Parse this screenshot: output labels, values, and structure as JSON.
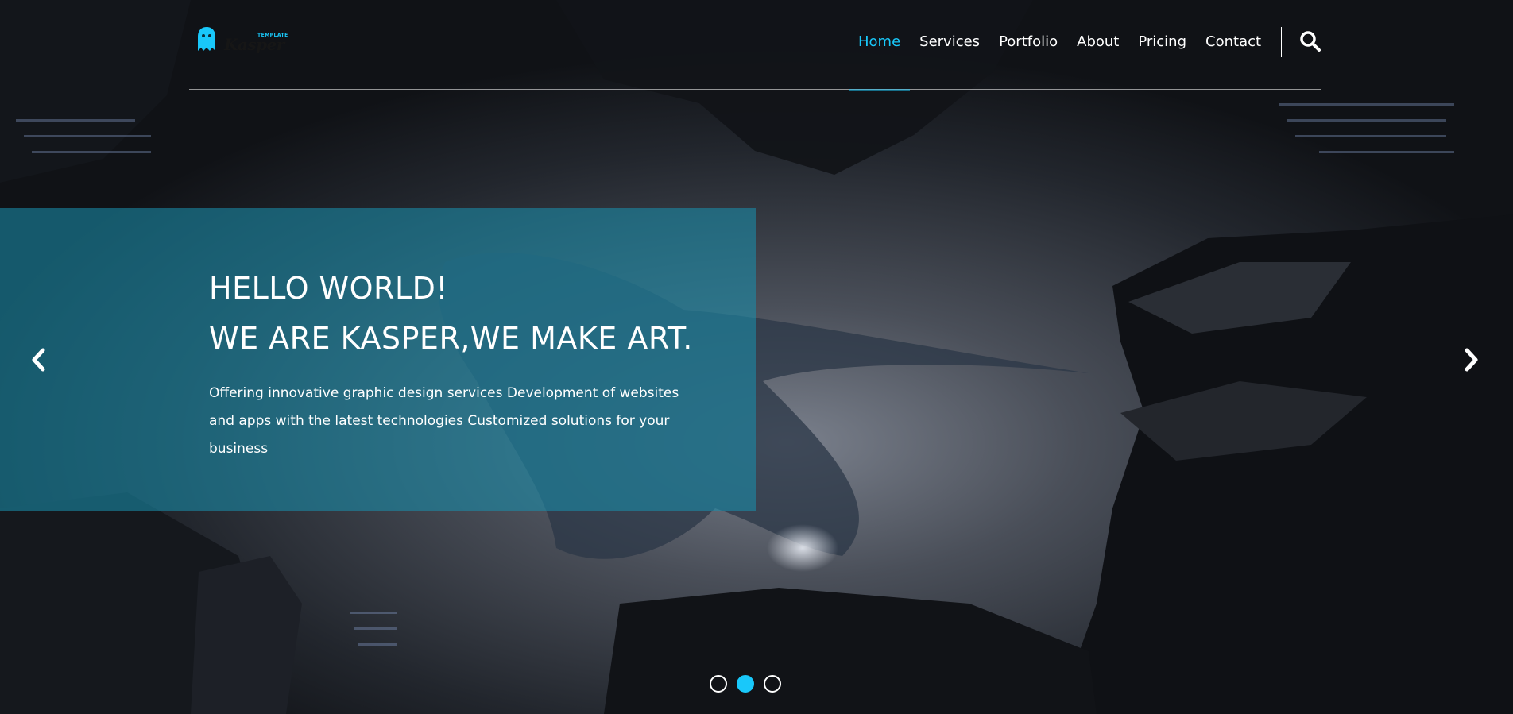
{
  "brand": {
    "name": "Kasper",
    "tagline": "TEMPLATE",
    "accent_color": "#19c8fa"
  },
  "nav": {
    "items": [
      {
        "label": "Home",
        "active": true
      },
      {
        "label": "Services",
        "active": false
      },
      {
        "label": "Portfolio",
        "active": false
      },
      {
        "label": "About",
        "active": false
      },
      {
        "label": "Pricing",
        "active": false
      },
      {
        "label": "Contact",
        "active": false
      }
    ],
    "search_icon": "search-icon"
  },
  "hero": {
    "title_line1": "HELLO WORLD!",
    "title_line2": "WE ARE KASPER,WE MAKE ART.",
    "description": "Offering innovative graphic design services Development of websites and apps with the latest technologies Customized solutions for your business",
    "panel_color": "#198eaa"
  },
  "slider": {
    "prev_icon": "chevron-left-icon",
    "next_icon": "chevron-right-icon",
    "bullet_count": 3,
    "active_bullet": 2
  }
}
